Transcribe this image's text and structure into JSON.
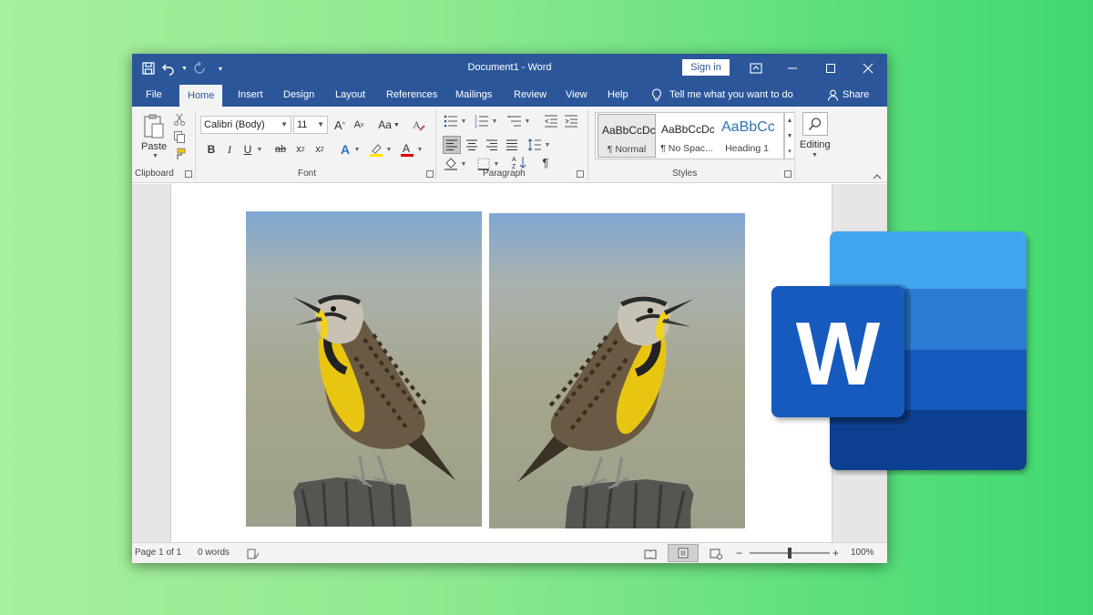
{
  "window": {
    "title": "Document1  -  Word",
    "sign_in": "Sign in"
  },
  "tabs": [
    "File",
    "Home",
    "Insert",
    "Design",
    "Layout",
    "References",
    "Mailings",
    "Review",
    "View",
    "Help"
  ],
  "active_tab": "Home",
  "tell_me": "Tell me what you want to do",
  "share": "Share",
  "ribbon": {
    "clipboard": {
      "label": "Clipboard",
      "paste": "Paste"
    },
    "font": {
      "label": "Font",
      "name": "Calibri (Body)",
      "size": "11",
      "case": "Aa"
    },
    "paragraph": {
      "label": "Paragraph"
    },
    "styles": {
      "label": "Styles",
      "items": [
        {
          "preview": "AaBbCcDc",
          "name": "¶ Normal"
        },
        {
          "preview": "AaBbCcDc",
          "name": "¶ No Spac..."
        },
        {
          "preview": "AaBbCc",
          "name": "Heading 1"
        }
      ]
    },
    "editing": {
      "label": "Editing"
    }
  },
  "status": {
    "page": "Page 1 of 1",
    "words": "0 words",
    "zoom": "100%",
    "zoom_percent": 100
  },
  "logo": {
    "letter": "W"
  },
  "colors": {
    "word_blue": "#2b579a",
    "ribbon_bg": "#f3f3f3",
    "logo_light": "#41a5ee",
    "logo_mid": "#2b7cd3",
    "logo_dark": "#185abd",
    "logo_darkest": "#103f91"
  }
}
